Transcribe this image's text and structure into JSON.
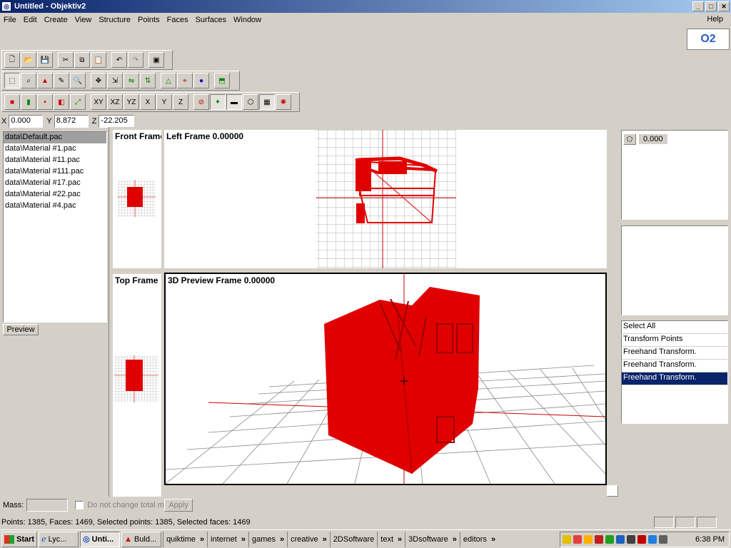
{
  "window": {
    "title": "Untitled - Objektiv2"
  },
  "menu": [
    "File",
    "Edit",
    "Create",
    "View",
    "Structure",
    "Points",
    "Faces",
    "Surfaces",
    "Window"
  ],
  "help": "Help",
  "logo": "O2",
  "toolbar3_text": {
    "xy": "XY",
    "xz": "XZ",
    "yz": "YZ",
    "x": "X",
    "y": "Y",
    "z": "Z"
  },
  "coords": {
    "x_label": "X",
    "x": "0.000",
    "y_label": "Y",
    "y": "8.872",
    "z_label": "Z",
    "z": "-22.205"
  },
  "files": [
    "data\\Default.pac",
    "data\\Material #1.pac",
    "data\\Material #11.pac",
    "data\\Material #111.pac",
    "data\\Material #17.pac",
    "data\\Material #22.pac",
    "data\\Material #4.pac"
  ],
  "preview_button": "Preview",
  "viewports": {
    "front": "Front Frame",
    "left": "Left Frame 0.00000",
    "top": "Top Frame",
    "preview3d": "3D Preview Frame 0.00000"
  },
  "right_panel": {
    "anim_value": "0.000",
    "actions": [
      "Select All",
      "Transform Points",
      "Freehand Transform.",
      "Freehand Transform.",
      "Freehand Transform."
    ]
  },
  "mass": {
    "label": "Mass:",
    "checkbox_label": "Do not change total mass",
    "apply": "Apply"
  },
  "status": "Points: 1385, Faces: 1469, Selected points: 1385, Selected faces: 1469",
  "taskbar": {
    "start": "Start",
    "tasks": [
      "Lyc...",
      "Unti...",
      "Buld..."
    ],
    "quicklinks": [
      "quiktime",
      "internet",
      "games",
      "creative",
      "2DSoftware",
      "text",
      "3Dsoftware",
      "editors"
    ],
    "clock": "6:38 PM"
  },
  "colors": {
    "model_red": "#e00000",
    "selection_blue": "#0a246a"
  }
}
